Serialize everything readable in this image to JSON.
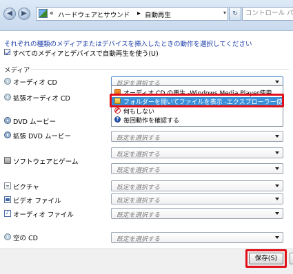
{
  "address_bar": {
    "breadcrumb_prefix": "«",
    "crumb1": "ハードウェアとサウンド",
    "separator": "▸",
    "crumb2": "自動再生",
    "dropdown": "▾",
    "refresh": "↻",
    "search_placeholder": "コントロール パネ"
  },
  "nav": {
    "back": "◀",
    "forward": "▶"
  },
  "instruction": "それぞれの種類のメディアまたはデバイスを挿入したときの動作を選択してください",
  "use_all_label": "すべてのメディアとデバイスで自動再生を使う(U)",
  "use_all_checked": true,
  "media_heading": "メディア",
  "rows": [
    {
      "label": "オーディオ CD",
      "icon": "audio-cd-icon",
      "combo": "既定を選択する"
    },
    {
      "label": "拡張オーディオ CD",
      "icon": "enhanced-audio-cd-icon"
    },
    {
      "label": "DVD ムービー",
      "icon": "dvd-movie-icon",
      "combo": "既定を選択する"
    },
    {
      "label": "拡張 DVD ムービー",
      "icon": "enhanced-dvd-icon",
      "combo": "既定を選択する"
    },
    {
      "label": "ソフトウェアとゲーム",
      "icon": "software-games-icon",
      "combo": "既定を選択する"
    },
    {
      "label": "ピクチャ",
      "icon": "pictures-icon",
      "combo": "既定を選択する"
    },
    {
      "label": "ビデオ ファイル",
      "icon": "video-file-icon",
      "combo": "既定を選択する"
    },
    {
      "label": "オーディオ ファイル",
      "icon": "audio-file-icon",
      "combo": "既定を選択する"
    },
    {
      "label": "空の CD",
      "icon": "blank-cd-icon",
      "combo": "既定を選択する"
    }
  ],
  "dropdown_options": [
    "オーディオ CD の再生 -Windows Media Player使用",
    "フォルダーを開いてファイルを表示 -エクスプローラー使用",
    "何もしない",
    "毎回動作を確認する"
  ],
  "selected_option_index": 1,
  "opt3_glyph": "?",
  "save_label": "保存(S)",
  "colors": {
    "highlight_border": "#e0101a",
    "selection": "#3a8fd9",
    "instruction_text": "#1a3caa"
  }
}
